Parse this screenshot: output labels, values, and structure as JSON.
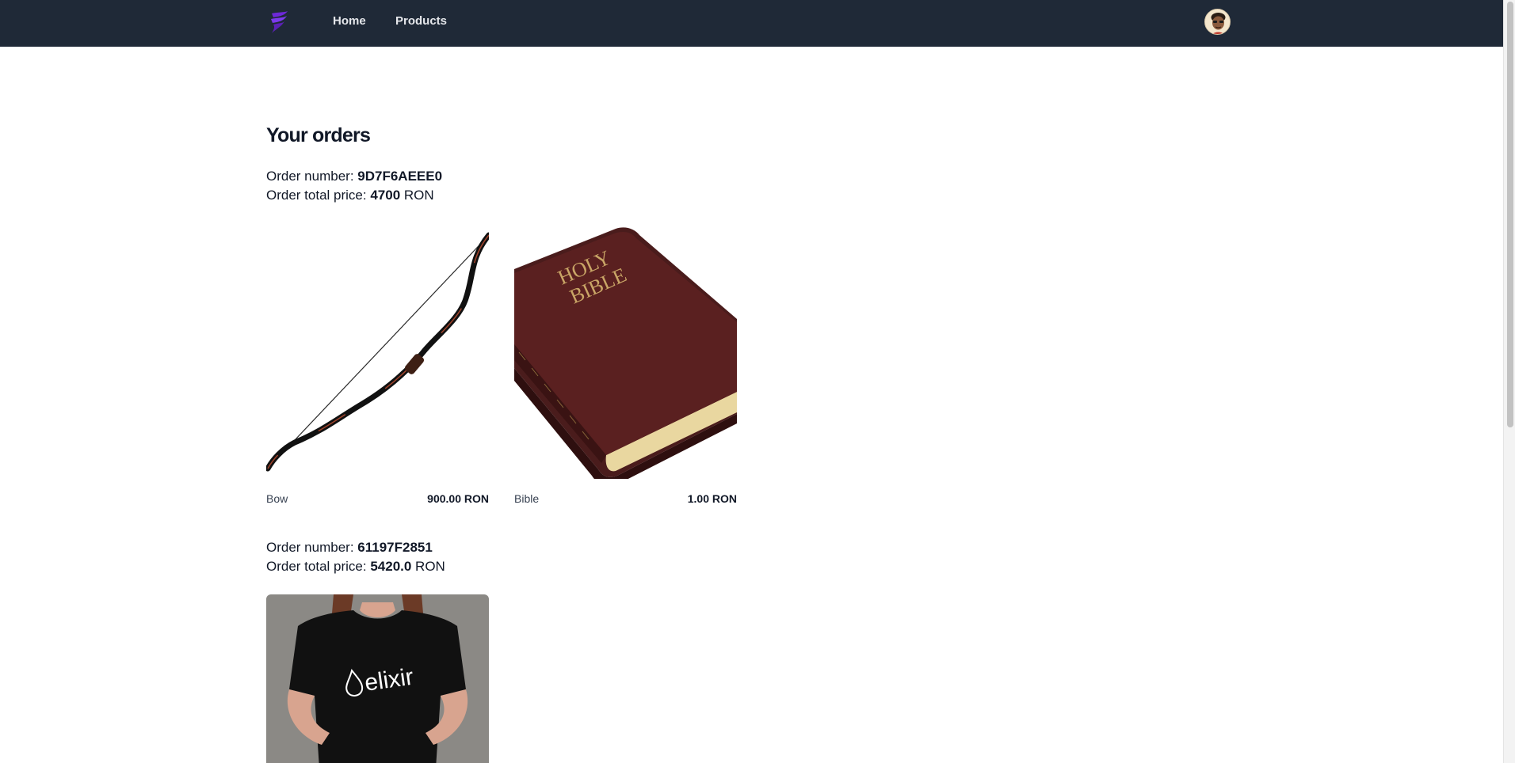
{
  "nav": {
    "home_label": "Home",
    "products_label": "Products"
  },
  "page": {
    "title": "Your orders"
  },
  "orders": [
    {
      "number_label": "Order number: ",
      "number": "9D7F6AEEE0",
      "total_label": "Order total price: ",
      "total": "4700",
      "currency": " RON",
      "items": [
        {
          "name": "Bow",
          "price": "900.00 RON",
          "image": "bow"
        },
        {
          "name": "Bible",
          "price": "1.00 RON",
          "image": "holy-bible-book",
          "cover_text_1": "HOLY",
          "cover_text_2": "BIBLE"
        }
      ]
    },
    {
      "number_label": "Order number: ",
      "number": "61197F2851",
      "total_label": "Order total price: ",
      "total": "5420.0",
      "currency": " RON",
      "items": [
        {
          "image": "elixir-tshirt",
          "shirt_text": "elixir"
        }
      ]
    }
  ],
  "colors": {
    "navbar": "#1f2937",
    "logo": "#6d28d9",
    "page_bg": "#ffffff"
  }
}
